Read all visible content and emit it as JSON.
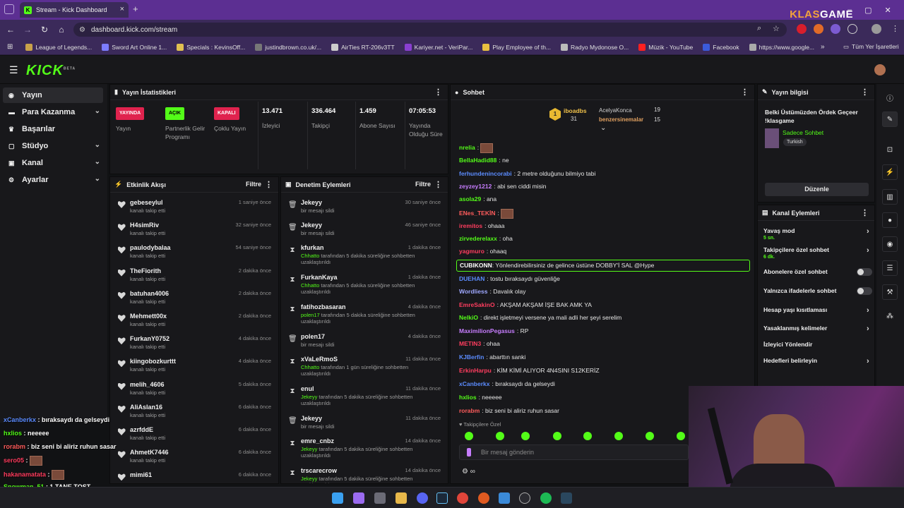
{
  "browser": {
    "tab_title": "Stream - Kick Dashboard",
    "tab_close": "×",
    "new_tab": "+",
    "brand_a": "KLAS",
    "brand_b": "GAME",
    "url": "dashboard.kick.com/stream"
  },
  "bookmarks": [
    {
      "label": "League of Legends...",
      "color": "#c9a24a"
    },
    {
      "label": "Sword Art Online 1...",
      "color": "#7c7cff"
    },
    {
      "label": "Specials : KevinsOff...",
      "color": "#e0c050"
    },
    {
      "label": "justindbrown.co.uk/...",
      "color": "#777777"
    },
    {
      "label": "AirTies RT-206v3TT",
      "color": "#cccccc"
    },
    {
      "label": "Kariyer.net - VeriPar...",
      "color": "#8a3fd1"
    },
    {
      "label": "Play Employee of th...",
      "color": "#e8c040"
    },
    {
      "label": "Radyo Mydonose O...",
      "color": "#bbbbbb"
    },
    {
      "label": "Müzik - YouTube",
      "color": "#ff2020"
    },
    {
      "label": "Facebook",
      "color": "#3b5bdb"
    },
    {
      "label": "https://www.google...",
      "color": "#aaaaaa"
    }
  ],
  "bookmarks_more": "»",
  "bookmarks_all": "Tüm Yer İşaretleri",
  "kick": {
    "logo": "KICK",
    "beta": "BETA"
  },
  "sidebar": [
    {
      "label": "Yayın",
      "icon": "broadcast-icon",
      "chevron": ""
    },
    {
      "label": "Para Kazanma",
      "icon": "money-icon",
      "chevron": "⌄"
    },
    {
      "label": "Başarılar",
      "icon": "trophy-icon",
      "chevron": ""
    },
    {
      "label": "Stüdyo",
      "icon": "studio-icon",
      "chevron": "⌄"
    },
    {
      "label": "Kanal",
      "icon": "channel-icon",
      "chevron": "⌄"
    },
    {
      "label": "Ayarlar",
      "icon": "gear-icon",
      "chevron": "⌄"
    }
  ],
  "stats": {
    "title": "Yayın İstatistikleri",
    "cols": [
      {
        "badge": "YAYINDA",
        "badge_color": "#e0234e",
        "label": "Yayın"
      },
      {
        "badge": "AÇIK",
        "badge_color": "#53fc18",
        "label": "Partnerlik Gelir Programı"
      },
      {
        "badge": "KAPALI",
        "badge_color": "#e0234e",
        "label": "Çoklu Yayın"
      },
      {
        "value": "13.471",
        "label": "İzleyici"
      },
      {
        "value": "336.464",
        "label": "Takipçi"
      },
      {
        "value": "1.459",
        "label": "Abone Sayısı"
      },
      {
        "value": "07:05:53",
        "label": "Yayında Olduğu Süre"
      }
    ]
  },
  "activity": {
    "title": "Etkinlik Akışı",
    "filter": "Filtre",
    "items": [
      {
        "name": "gebeseylul",
        "sub": "kanalı takip etti",
        "time": "1 saniye önce"
      },
      {
        "name": "H4simRiv",
        "sub": "kanalı takip etti",
        "time": "32 saniye önce"
      },
      {
        "name": "paulodybalaa",
        "sub": "kanalı takip etti",
        "time": "54 saniye önce"
      },
      {
        "name": "TheFiorith",
        "sub": "kanalı takip etti",
        "time": "2 dakika önce"
      },
      {
        "name": "batuhan4006",
        "sub": "kanalı takip etti",
        "time": "2 dakika önce"
      },
      {
        "name": "Mehmett00x",
        "sub": "kanalı takip etti",
        "time": "2 dakika önce"
      },
      {
        "name": "FurkanY0752",
        "sub": "kanalı takip etti",
        "time": "4 dakika önce"
      },
      {
        "name": "kiingobozkurttt",
        "sub": "kanalı takip etti",
        "time": "4 dakika önce"
      },
      {
        "name": "melih_4606",
        "sub": "kanalı takip etti",
        "time": "5 dakika önce"
      },
      {
        "name": "AliAslan16",
        "sub": "kanalı takip etti",
        "time": "6 dakika önce"
      },
      {
        "name": "azrfddE",
        "sub": "kanalı takip etti",
        "time": "6 dakika önce"
      },
      {
        "name": "AhmetK7446",
        "sub": "kanalı takip etti",
        "time": "6 dakika önce"
      },
      {
        "name": "mimi61",
        "sub": "",
        "time": "6 dakika önce"
      }
    ]
  },
  "moderation": {
    "title": "Denetim Eylemleri",
    "filter": "Filtre",
    "items": [
      {
        "name": "Jekeyy",
        "mod": "",
        "sub": "bir mesajı sildi",
        "time": "30 saniye önce",
        "icon": "trash-icon"
      },
      {
        "name": "Jekeyy",
        "mod": "",
        "sub": "bir mesajı sildi",
        "time": "46 saniye önce",
        "icon": "trash-icon"
      },
      {
        "name": "kfurkan",
        "mod": "Chhatto",
        "sub": " tarafından 5 dakika süreliğine sohbetten uzaklaştırıldı",
        "time": "1 dakika önce",
        "icon": "hourglass-icon"
      },
      {
        "name": "FurkanKaya",
        "mod": "Chhatto",
        "sub": " tarafından 5 dakika süreliğine sohbetten uzaklaştırıldı",
        "time": "1 dakika önce",
        "icon": "hourglass-icon"
      },
      {
        "name": "fatihozbasaran",
        "mod": "polen17",
        "sub": " tarafından 5 dakika süreliğine sohbetten uzaklaştırıldı",
        "time": "4 dakika önce",
        "icon": "hourglass-icon"
      },
      {
        "name": "polen17",
        "mod": "",
        "sub": "bir mesajı sildi",
        "time": "4 dakika önce",
        "icon": "trash-icon"
      },
      {
        "name": "xVaLeRmoS",
        "mod": "Chhatto",
        "sub": " tarafından 1 gün süreliğine sohbetten uzaklaştırıldı",
        "time": "11 dakika önce",
        "icon": "hourglass-icon"
      },
      {
        "name": "enul",
        "mod": "Jekeyy",
        "sub": " tarafından 5 dakika süreliğine sohbetten uzaklaştırıldı",
        "time": "11 dakika önce",
        "icon": "hourglass-icon"
      },
      {
        "name": "Jekeyy",
        "mod": "",
        "sub": "bir mesajı sildi",
        "time": "11 dakika önce",
        "icon": "trash-icon"
      },
      {
        "name": "emre_cnbz",
        "mod": "Jekeyy",
        "sub": " tarafından 5 dakika süreliğine sohbetten uzaklaştırıldı",
        "time": "14 dakika önce",
        "icon": "hourglass-icon"
      },
      {
        "name": "trscarecrow",
        "mod": "Jekeyy",
        "sub": " tarafından 5 dakika süreliğine sohbetten uzaklaştırıldı",
        "time": "14 dakika önce",
        "icon": "hourglass-icon"
      }
    ]
  },
  "chat": {
    "title": "Sohbet",
    "top": [
      {
        "rank": "1",
        "name": "iboadbs",
        "count": "31"
      },
      {
        "name": "AcelyaKonca",
        "count": "19"
      },
      {
        "name": "benzersinemalar",
        "count": "15"
      }
    ],
    "messages": [
      {
        "user": "nrelia",
        "color": "#53fc18",
        "text": "",
        "emote": true
      },
      {
        "user": "BellaHadid88",
        "color": "#53fc18",
        "text": "ne"
      },
      {
        "user": "ferhundenincorabi",
        "color": "#5b8cff",
        "text": "2 metre olduğunu bilmiyo tabi"
      },
      {
        "user": "zeyzey1212",
        "color": "#c77dff",
        "text": "abi sen ciddi misin"
      },
      {
        "user": "asola29",
        "color": "#53fc18",
        "text": "ana"
      },
      {
        "user": "ENes_TEKİN",
        "color": "#ff5c5c",
        "text": "",
        "emote": true
      },
      {
        "user": "iremitos",
        "color": "#ff3d5f",
        "text": "ohaaa"
      },
      {
        "user": "zirvederelaxx",
        "color": "#53fc18",
        "text": "oha"
      },
      {
        "user": "yagmuro",
        "color": "#ff3d5f",
        "text": "ohaaq"
      },
      {
        "user": "DUEHAN",
        "color": "#5b8cff",
        "text": "tostu bıraksaydı güvenliğe"
      },
      {
        "user": "Wordliess",
        "color": "#9fa8ff",
        "text": "Davalık olay"
      },
      {
        "user": "EmreSakinO",
        "color": "#ff3d5f",
        "text": "AKŞAM AKŞAM İŞE BAK AMK YA"
      },
      {
        "user": "NelkiO",
        "color": "#53fc18",
        "text": "direkt işletmeyi versene ya mali adli her şeyi serelim"
      },
      {
        "user": "MaximilionPegasus",
        "color": "#c77dff",
        "text": "RP"
      },
      {
        "user": "METIN3",
        "color": "#ff3d5f",
        "text": "ohaa"
      },
      {
        "user": "KJBerfin",
        "color": "#5b8cff",
        "text": "abarttın sanki"
      },
      {
        "user": "ErkinHarpu",
        "color": "#ff3d5f",
        "text": "KİM KİMİ ALIYOR 4N4SINI S12KERİZ"
      },
      {
        "user": "xCanberkx",
        "color": "#5b8cff",
        "text": "bıraksaydı da gelseydi"
      },
      {
        "user": "hxlios",
        "color": "#53fc18",
        "text": "neeeee"
      },
      {
        "user": "rorabm",
        "color": "#ff5c5c",
        "text": "biz seni bi aliriz ruhun sasar"
      }
    ],
    "highlight": {
      "user": "CUBIKONN",
      "text": "Yönlendirebilirsiniz de gelince üstüne DOBBY'İ SAL @Hype"
    },
    "followers_only": "Takipçilere Özel",
    "placeholder": "Bir mesaj gönderin",
    "settings_label": "∞"
  },
  "info": {
    "title": "Yayın bilgisi",
    "stream_title": "Belki Üstümüzden Ördek Geçeer !klasgame",
    "category": "Sadece Sohbet",
    "tag": "Turkish",
    "edit": "Düzenle"
  },
  "actions": {
    "title": "Kanal Eylemleri",
    "items": [
      {
        "label": "Yavaş mod",
        "sub": "5 sn.",
        "type": "arrow"
      },
      {
        "label": "Takipçilere özel sohbet",
        "sub": "6 dk.",
        "type": "arrow"
      },
      {
        "label": "Abonelere özel sohbet",
        "sub": "",
        "type": "toggle"
      },
      {
        "label": "Yalnızca ifadelerle sohbet",
        "sub": "",
        "type": "toggle"
      },
      {
        "label": "Hesap yaşı kısıtlaması",
        "sub": "",
        "type": "arrow"
      },
      {
        "label": "Yasaklanmış kelimeler",
        "sub": "",
        "type": "arrow"
      },
      {
        "label": "İzleyici Yönlendir",
        "sub": "",
        "type": "none"
      },
      {
        "label": "Hedefleri belirleyin",
        "sub": "",
        "type": "arrow"
      }
    ]
  },
  "overlay_chat": [
    {
      "user": "xCanberkx",
      "color": "#5b8cff",
      "text": "bıraksaydı da gelseydi"
    },
    {
      "user": "hxlios",
      "color": "#53fc18",
      "text": "neeeee"
    },
    {
      "user": "rorabm",
      "color": "#ff5c5c",
      "text": "biz seni bi aliriz ruhun sasar"
    },
    {
      "user": "sero05",
      "color": "#ff3d5f",
      "text": ""
    },
    {
      "user": "hakanamatata",
      "color": "#ff3d5f",
      "text": ""
    },
    {
      "user": "Snowman_51",
      "color": "#53fc18",
      "text": "1 TANE TOST..."
    }
  ]
}
